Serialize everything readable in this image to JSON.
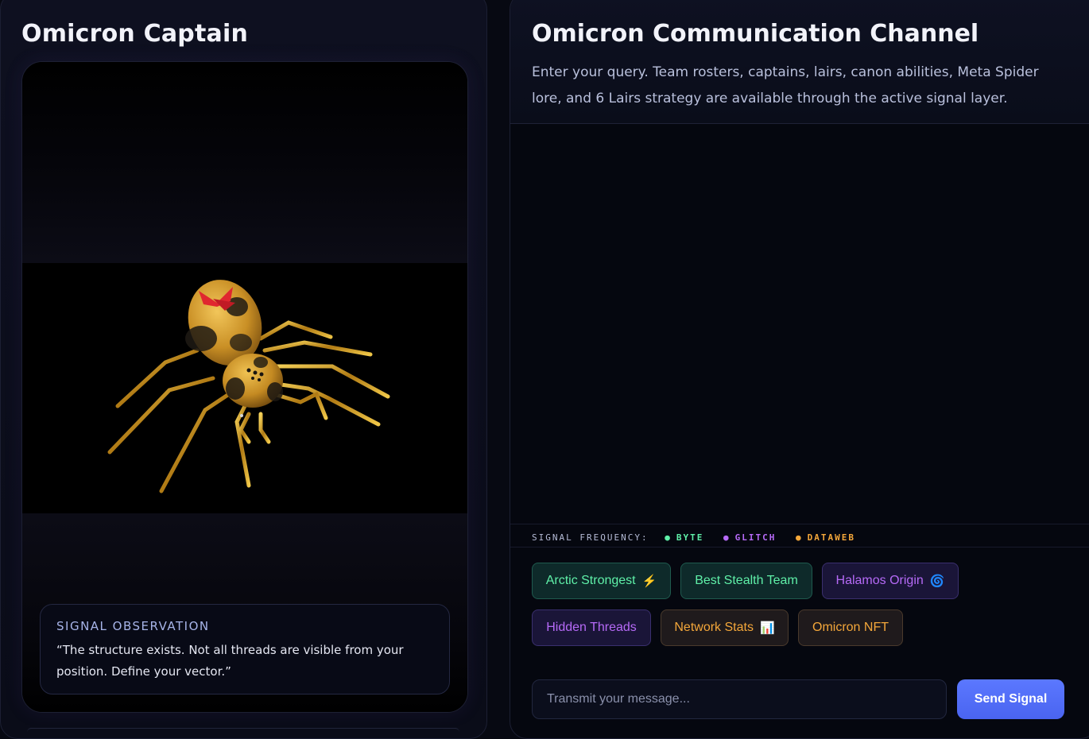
{
  "captain_panel": {
    "title": "Omicron Captain",
    "observation": {
      "label": "SIGNAL OBSERVATION",
      "line1": "“The structure exists. Not all threads are visible from your",
      "line2": "position. Define your vector.”"
    }
  },
  "channel": {
    "title": "Omicron Communication Channel",
    "description_line1": "Enter your query. Team rosters, captains, lairs, canon abilities, Meta Spider",
    "description_line2": "lore, and 6 Lairs strategy are available through the active signal layer."
  },
  "frequency": {
    "label": "SIGNAL FREQUENCY:",
    "items": [
      {
        "name": "BYTE",
        "color": "#5ff0a8"
      },
      {
        "name": "GLITCH",
        "color": "#b66af7"
      },
      {
        "name": "DATAWEB",
        "color": "#f4a73a"
      }
    ]
  },
  "quick_prompts": [
    {
      "label": "Arctic Strongest",
      "icon": "lightning-icon",
      "glyph": "⚡",
      "tone": "green"
    },
    {
      "label": "Best Stealth Team",
      "icon": "",
      "glyph": "",
      "tone": "green"
    },
    {
      "label": "Halamos Origin",
      "icon": "spiral-icon",
      "glyph": "🌀",
      "tone": "purple"
    },
    {
      "label": "Hidden Threads",
      "icon": "",
      "glyph": "",
      "tone": "purple"
    },
    {
      "label": "Network Stats",
      "icon": "bar-chart-icon",
      "glyph": "📊",
      "tone": "orange"
    },
    {
      "label": "Omicron NFT",
      "icon": "",
      "glyph": "",
      "tone": "orange"
    }
  ],
  "composer": {
    "placeholder": "Transmit your message...",
    "send_label": "Send Signal"
  }
}
